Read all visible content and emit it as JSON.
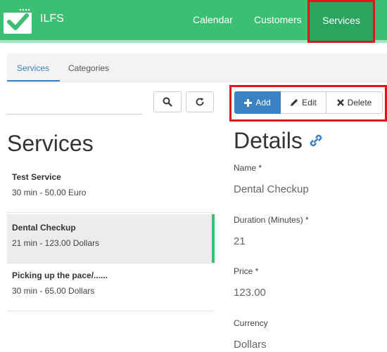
{
  "header": {
    "brand": "ILFS",
    "nav": [
      {
        "label": "Calendar"
      },
      {
        "label": "Customers"
      },
      {
        "label": "Services"
      }
    ],
    "accent_color": "#3bbf73",
    "active_nav": "Services"
  },
  "tabs": [
    {
      "label": "Services",
      "active": true
    },
    {
      "label": "Categories",
      "active": false
    }
  ],
  "search": {
    "placeholder": "",
    "value": ""
  },
  "services": {
    "heading": "Services",
    "items": [
      {
        "name": "Test Service",
        "meta": "30 min - 50.00 Euro",
        "selected": false
      },
      {
        "name": "Dental Checkup",
        "meta": "21 min - 123.00 Dollars",
        "selected": true
      },
      {
        "name": "Picking up the pace/......",
        "meta": "30 min - 65.00 Dollars",
        "selected": false
      }
    ]
  },
  "actions": {
    "add": "Add",
    "edit": "Edit",
    "delete": "Delete"
  },
  "details": {
    "heading": "Details",
    "fields": [
      {
        "label": "Name *",
        "value": "Dental Checkup"
      },
      {
        "label": "Duration (Minutes) *",
        "value": "21"
      },
      {
        "label": "Price *",
        "value": "123.00"
      },
      {
        "label": "Currency",
        "value": "Dollars"
      }
    ]
  },
  "icons": [
    "logo-check-icon",
    "search-icon",
    "refresh-icon",
    "plus-icon",
    "pencil-icon",
    "x-icon",
    "link-icon"
  ]
}
